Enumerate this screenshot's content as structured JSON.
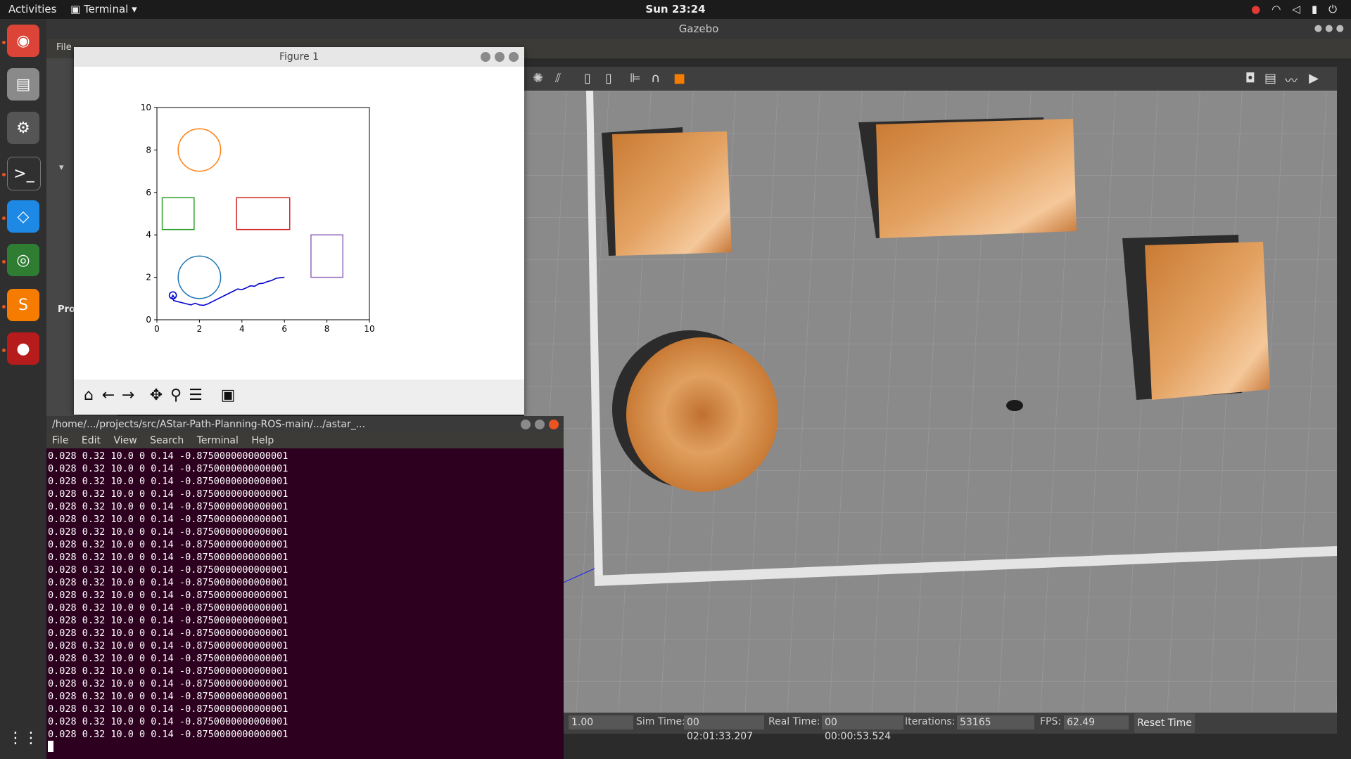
{
  "topbar": {
    "activities": "Activities",
    "app_name": "Terminal",
    "clock": "Sun 23:24",
    "tray_icons": [
      "record-icon",
      "wifi-icon",
      "volume-icon",
      "battery-icon",
      "power-icon"
    ]
  },
  "dock": {
    "items": [
      {
        "name": "chrome-icon",
        "color": "#db4437"
      },
      {
        "name": "files-icon",
        "color": "#8a8a8a"
      },
      {
        "name": "settings-icon",
        "color": "#555555"
      },
      {
        "name": "terminal-icon",
        "color": "#303030"
      },
      {
        "name": "vscode-icon",
        "color": "#1e88e5"
      },
      {
        "name": "gazebo-icon",
        "color": "#2e7d32"
      },
      {
        "name": "sublime-icon",
        "color": "#f57c00"
      },
      {
        "name": "recorder-icon",
        "color": "#b71c1c"
      }
    ]
  },
  "gazebo": {
    "title": "Gazebo",
    "menu_first": "File",
    "left_panel_label": "Pro",
    "bottom": {
      "rtf": "1.00",
      "sim_label": "Sim Time:",
      "sim_value": "00 02:01:33.207",
      "real_label": "Real Time:",
      "real_value": "00 00:00:53.524",
      "iter_label": "Iterations:",
      "iter_value": "53165",
      "fps_label": "FPS:",
      "fps_value": "62.49",
      "reset_label": "Reset Time"
    }
  },
  "figure": {
    "title": "Figure 1",
    "toolbar_icons": [
      "home-icon",
      "back-icon",
      "forward-icon",
      "pan-icon",
      "zoom-icon",
      "configure-icon",
      "save-icon"
    ]
  },
  "chart_data": {
    "type": "line",
    "title": "",
    "xlabel": "",
    "ylabel": "",
    "xlim": [
      0,
      10
    ],
    "ylim": [
      0,
      10
    ],
    "xticks": [
      "0",
      "2",
      "4",
      "6",
      "8",
      "10"
    ],
    "yticks": [
      "0",
      "2",
      "4",
      "6",
      "8",
      "10"
    ],
    "obstacles": [
      {
        "shape": "circle",
        "cx": 2,
        "cy": 8,
        "r": 1,
        "color": "#ff7f0e"
      },
      {
        "shape": "circle",
        "cx": 2,
        "cy": 2,
        "r": 1,
        "color": "#1f77b4"
      },
      {
        "shape": "rect",
        "x0": 0.25,
        "y0": 4.25,
        "x1": 1.75,
        "y1": 5.75,
        "color": "#2ca02c"
      },
      {
        "shape": "rect",
        "x0": 3.75,
        "y0": 4.25,
        "x1": 6.25,
        "y1": 5.75,
        "color": "#d62728"
      },
      {
        "shape": "rect",
        "x0": 7.25,
        "y0": 2.0,
        "x1": 8.75,
        "y1": 4.0,
        "color": "#9467bd"
      }
    ],
    "path": {
      "color": "#0000cc",
      "x": [
        0.85,
        0.75,
        0.7,
        0.8,
        1.0,
        1.2,
        1.4,
        1.6,
        1.8,
        2.0,
        2.2,
        2.4,
        2.6,
        2.8,
        3.0,
        3.2,
        3.4,
        3.6,
        3.8,
        4.0,
        4.2,
        4.4,
        4.6,
        4.8,
        5.0,
        5.2,
        5.4,
        5.6,
        5.8,
        6.0
      ],
      "y": [
        1.0,
        1.15,
        1.05,
        0.9,
        0.85,
        0.8,
        0.75,
        0.7,
        0.78,
        0.7,
        0.68,
        0.75,
        0.85,
        0.95,
        1.05,
        1.15,
        1.25,
        1.35,
        1.45,
        1.42,
        1.5,
        1.6,
        1.58,
        1.7,
        1.72,
        1.8,
        1.85,
        1.95,
        1.98,
        2.0
      ]
    }
  },
  "terminal": {
    "title": "/home/.../projects/src/AStar-Path-Planning-ROS-main/.../astar_...",
    "menu": [
      "File",
      "Edit",
      "View",
      "Search",
      "Terminal",
      "Help"
    ],
    "output_line": "0.028 0.32 10.0 0 0.14 -0.8750000000000001",
    "line_count": 23
  },
  "colors": {
    "terminal_bg": "#2c001e",
    "gazebo_ground": "#8a8a8a",
    "wood": "#d48a3c"
  }
}
